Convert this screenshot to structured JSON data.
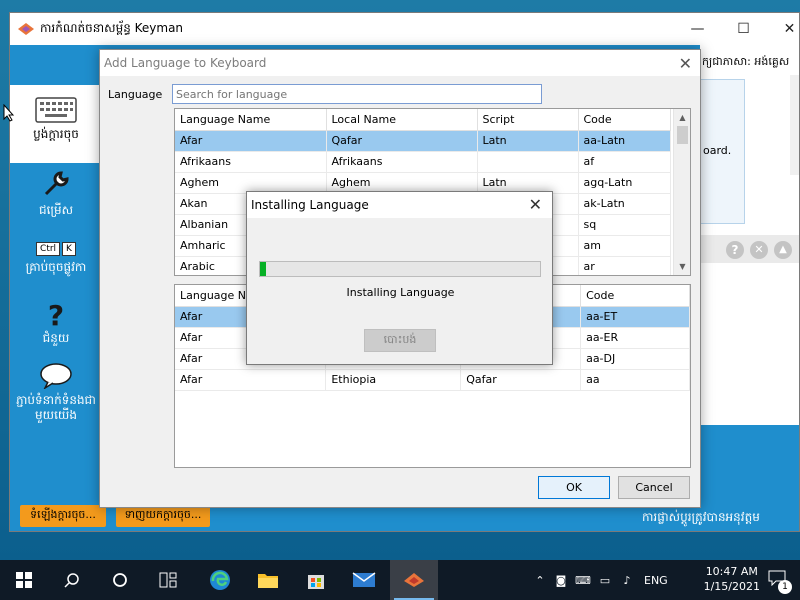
{
  "main_window": {
    "title": "ការកំណត់ចនាសម្ព័ន្ធ Keyman",
    "minimize": "—",
    "maximize": "☐",
    "close": "✕",
    "right_text_top": "ក្យជាភាសា: អង់គ្លេស",
    "right_text_mid": "oard.",
    "bottom_right_text": "ការផ្លាស់ប្តូរត្រូវបានអនុវត្តម",
    "nav": [
      {
        "label": "ប្លង់ក្តារចុច",
        "icon": "keyboard-icon"
      },
      {
        "label": "ជម្រើស",
        "icon": "wrench-icon"
      },
      {
        "label": "គ្រាប់ចុចផ្លូវកា",
        "icon": "hotkey-icon",
        "key1": "Ctrl",
        "key2": "K"
      },
      {
        "label": "ជំនួយ",
        "icon": "help-icon",
        "glyph": "?"
      },
      {
        "label": "ភ្ជាប់ទំនាក់ទំនងជាមួយយើង",
        "icon": "chat-bubble-icon"
      }
    ],
    "download_button": "ទំឡើងក្តារចុច...",
    "get_keyboard_button": "ទាញយកក្តារចុច..."
  },
  "add_language_dialog": {
    "title": "Add Language to Keyboard",
    "close": "✕",
    "search_label": "Language",
    "search_placeholder": "Search for language",
    "top_columns": [
      "Language Name",
      "Local Name",
      "Script",
      "Code"
    ],
    "top_rows": [
      [
        "Afar",
        "Qafar",
        "Latn",
        "aa-Latn"
      ],
      [
        "Afrikaans",
        "Afrikaans",
        "",
        "af"
      ],
      [
        "Aghem",
        "Aghem",
        "Latn",
        "agq-Latn"
      ],
      [
        "Akan",
        "",
        "",
        "ak-Latn"
      ],
      [
        "Albanian",
        "",
        "",
        "sq"
      ],
      [
        "Amharic",
        "",
        "",
        "am"
      ],
      [
        "Arabic",
        "",
        "",
        "ar"
      ]
    ],
    "bottom_columns": [
      "Language Name",
      "",
      "",
      "Code"
    ],
    "bottom_rows": [
      [
        "Afar",
        "",
        "",
        "aa-ET"
      ],
      [
        "Afar",
        "",
        "",
        "aa-ER"
      ],
      [
        "Afar",
        "",
        "",
        "aa-DJ"
      ],
      [
        "Afar",
        "Ethiopia",
        "Qafar",
        "aa"
      ]
    ],
    "ok": "OK",
    "cancel": "Cancel"
  },
  "installing_dialog": {
    "title": "Installing Language",
    "close": "✕",
    "message": "Installing Language",
    "progress_fraction": 0.02,
    "cancel": "បោះបង់"
  },
  "taskbar": {
    "language": "ENG",
    "time": "10:47 AM",
    "date": "1/15/2021",
    "notification_count": "1"
  }
}
